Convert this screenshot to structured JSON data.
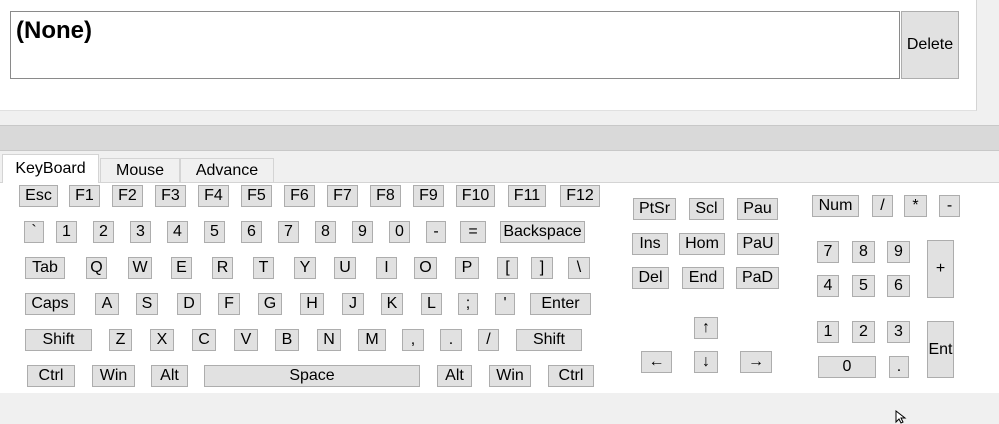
{
  "display": {
    "text": "(None)",
    "delete_label": "Delete"
  },
  "tabs": [
    "KeyBoard",
    "Mouse",
    "Advance"
  ],
  "keys": {
    "esc": "Esc",
    "f1": "F1",
    "f2": "F2",
    "f3": "F3",
    "f4": "F4",
    "f5": "F5",
    "f6": "F6",
    "f7": "F7",
    "f8": "F8",
    "f9": "F9",
    "f10": "F10",
    "f11": "F11",
    "f12": "F12",
    "backtick": "`",
    "d1": "1",
    "d2": "2",
    "d3": "3",
    "d4": "4",
    "d5": "5",
    "d6": "6",
    "d7": "7",
    "d8": "8",
    "d9": "9",
    "d0": "0",
    "minus": "-",
    "equals": "=",
    "backspace": "Backspace",
    "tab": "Tab",
    "q": "Q",
    "w": "W",
    "e": "E",
    "r": "R",
    "t": "T",
    "y": "Y",
    "u": "U",
    "i": "I",
    "o": "O",
    "p": "P",
    "lbracket": "[",
    "rbracket": "]",
    "backslash": "\\",
    "caps": "Caps",
    "a": "A",
    "s": "S",
    "d": "D",
    "f": "F",
    "g": "G",
    "h": "H",
    "j": "J",
    "k": "K",
    "l": "L",
    "semicolon": ";",
    "quote": "'",
    "enter": "Enter",
    "lshift": "Shift",
    "z": "Z",
    "x": "X",
    "c": "C",
    "v": "V",
    "b": "B",
    "n": "N",
    "m": "M",
    "comma": ",",
    "period": ".",
    "slash": "/",
    "rshift": "Shift",
    "lctrl": "Ctrl",
    "lwin": "Win",
    "lalt": "Alt",
    "space": "Space",
    "ralt": "Alt",
    "rwin": "Win",
    "rctrl": "Ctrl",
    "ptsr": "PtSr",
    "scl": "Scl",
    "pau": "Pau",
    "ins": "Ins",
    "hom": "Hom",
    "pgup": "PaU",
    "del": "Del",
    "end": "End",
    "pgdn": "PaD",
    "up": "↑",
    "left": "←",
    "down": "↓",
    "right": "→",
    "num": "Num",
    "np_div": "/",
    "np_mul": "*",
    "np_sub": "-",
    "np7": "7",
    "np8": "8",
    "np9": "9",
    "np_add": "+",
    "np4": "4",
    "np5": "5",
    "np6": "6",
    "np1": "1",
    "np2": "2",
    "np3": "3",
    "np_ent": "Ent",
    "np0": "0",
    "np_dot": "."
  }
}
